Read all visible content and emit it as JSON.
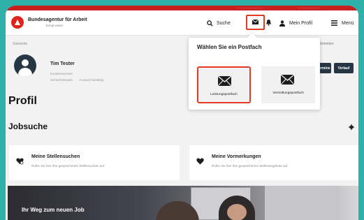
{
  "header": {
    "brand_name": "Bundesagentur für Arbeit",
    "brand_tagline": "bringt weiter",
    "search_label": "Suche",
    "profile_label": "Mein Profil",
    "menu_label": "Menü",
    "accent_color": "#e2231a",
    "frame_color": "#2eb1a9"
  },
  "breadcrumb": {
    "current": "Startseite"
  },
  "ghost": {
    "login_right": "Abmelden",
    "login_left": "igen"
  },
  "user": {
    "name": "Tim Tester",
    "customer_number_label": "Kundennummer",
    "security_label": "Sicherheitsstufe",
    "security_value": "Ausweis bestätigt"
  },
  "actions": {
    "termine": "Termine",
    "verlauf": "Verlauf"
  },
  "page": {
    "title": "Profil",
    "section": "Jobsuche"
  },
  "cards": [
    {
      "title": "Meine Stellensuchen",
      "description": "Rufen Sie hier Ihre gespeicherten Stellensuchen auf",
      "icon": "heart-search-icon"
    },
    {
      "title": "Meine Vormerkungen",
      "description": "Rufen Sie hier Ihre gespeicherten Stellenangebote auf",
      "icon": "heart-icon"
    }
  ],
  "hero": {
    "text": "Ihr Weg zum neuen Job"
  },
  "dropdown": {
    "title": "Wählen Sie ein Postfach",
    "options": [
      {
        "label": "Leistungspostfach",
        "selected": true,
        "icon": "mail-icon"
      },
      {
        "label": "Vermittlungspostfach",
        "selected": false,
        "icon": "mail-icon"
      }
    ]
  }
}
